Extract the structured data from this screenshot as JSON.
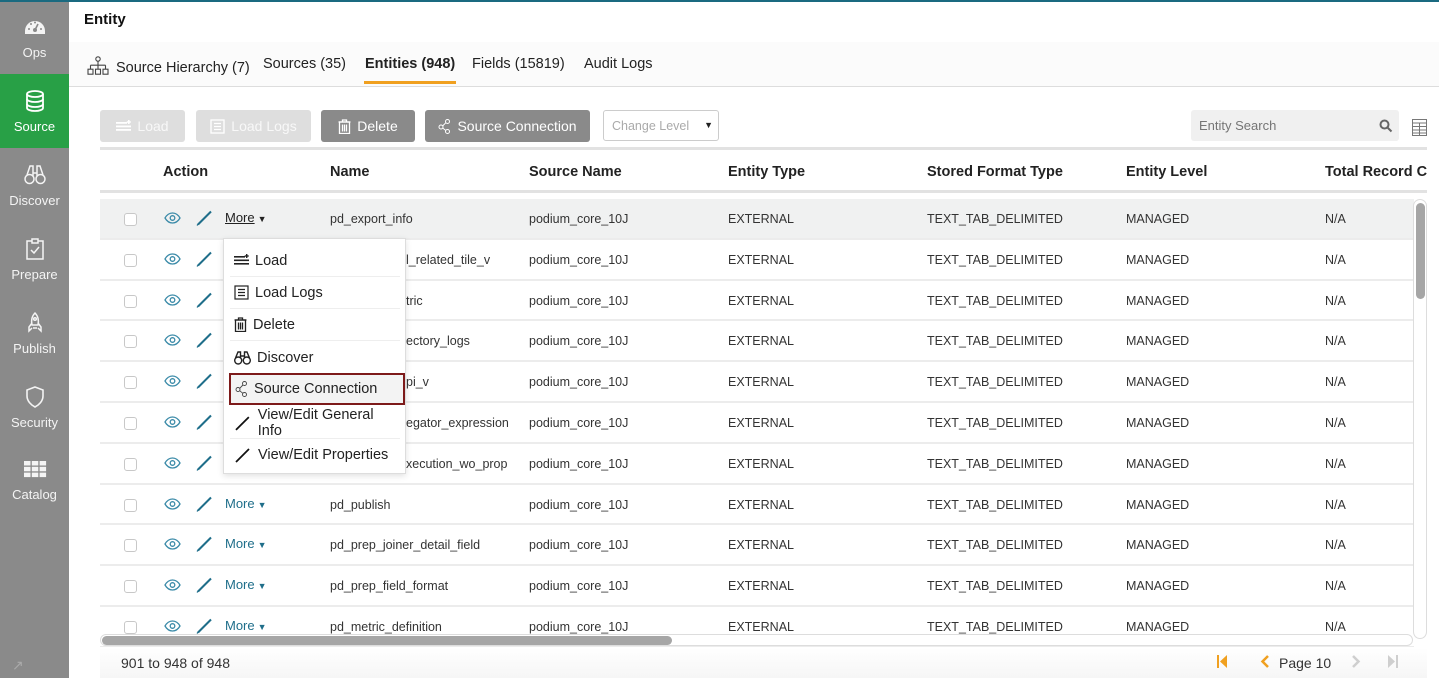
{
  "sidebar": {
    "items": [
      {
        "label": "Ops",
        "icon": "dashboard-gauge-icon",
        "active": false
      },
      {
        "label": "Source",
        "icon": "database-icon",
        "active": true
      },
      {
        "label": "Discover",
        "icon": "binoculars-icon",
        "active": false
      },
      {
        "label": "Prepare",
        "icon": "clipboard-check-icon",
        "active": false
      },
      {
        "label": "Publish",
        "icon": "rocket-icon",
        "active": false
      },
      {
        "label": "Security",
        "icon": "shield-icon",
        "active": false
      },
      {
        "label": "Catalog",
        "icon": "grid-icon",
        "active": false
      }
    ],
    "expand_icon": "↗"
  },
  "header": {
    "title": "Entity"
  },
  "tabs": [
    {
      "label": "Source Hierarchy (7)",
      "icon": "hierarchy-icon"
    },
    {
      "label": "Sources (35)"
    },
    {
      "label": "Entities (948)",
      "active": true
    },
    {
      "label": "Fields (15819)"
    },
    {
      "label": "Audit Logs"
    }
  ],
  "toolbar": {
    "load": "Load",
    "load_logs": "Load Logs",
    "delete": "Delete",
    "source_connection": "Source Connection",
    "change_level_placeholder": "Change Level",
    "search_placeholder": "Entity Search"
  },
  "table": {
    "columns": [
      "Action",
      "Name",
      "Source Name",
      "Entity Type",
      "Stored Format Type",
      "Entity Level",
      "Total Record Cou"
    ],
    "more_label": "More",
    "rows": [
      {
        "name": "pd_export_info",
        "source": "podium_core_10J",
        "type": "EXTERNAL",
        "format": "TEXT_TAB_DELIMITED",
        "level": "MANAGED",
        "records": "N/A"
      },
      {
        "name": "pd_related_tile_v",
        "visible_name": "l_related_tile_v",
        "source": "podium_core_10J",
        "type": "EXTERNAL",
        "format": "TEXT_TAB_DELIMITED",
        "level": "MANAGED",
        "records": "N/A"
      },
      {
        "name": "tric",
        "visible_name": "tric",
        "source": "podium_core_10J",
        "type": "EXTERNAL",
        "format": "TEXT_TAB_DELIMITED",
        "level": "MANAGED",
        "records": "N/A"
      },
      {
        "name": "ectory_logs",
        "visible_name": "ectory_logs",
        "source": "podium_core_10J",
        "type": "EXTERNAL",
        "format": "TEXT_TAB_DELIMITED",
        "level": "MANAGED",
        "records": "N/A"
      },
      {
        "name": "pi_v",
        "visible_name": "pi_v",
        "source": "podium_core_10J",
        "type": "EXTERNAL",
        "format": "TEXT_TAB_DELIMITED",
        "level": "MANAGED",
        "records": "N/A"
      },
      {
        "name": "egator_expression",
        "visible_name": "egator_expression",
        "source": "podium_core_10J",
        "type": "EXTERNAL",
        "format": "TEXT_TAB_DELIMITED",
        "level": "MANAGED",
        "records": "N/A"
      },
      {
        "name": "xecution_wo_prop",
        "visible_name": "xecution_wo_prop",
        "source": "podium_core_10J",
        "type": "EXTERNAL",
        "format": "TEXT_TAB_DELIMITED",
        "level": "MANAGED",
        "records": "N/A"
      },
      {
        "name": "pd_publish",
        "source": "podium_core_10J",
        "type": "EXTERNAL",
        "format": "TEXT_TAB_DELIMITED",
        "level": "MANAGED",
        "records": "N/A"
      },
      {
        "name": "pd_prep_joiner_detail_field",
        "source": "podium_core_10J",
        "type": "EXTERNAL",
        "format": "TEXT_TAB_DELIMITED",
        "level": "MANAGED",
        "records": "N/A"
      },
      {
        "name": "pd_prep_field_format",
        "source": "podium_core_10J",
        "type": "EXTERNAL",
        "format": "TEXT_TAB_DELIMITED",
        "level": "MANAGED",
        "records": "N/A"
      },
      {
        "name": "pd_metric_definition",
        "source": "podium_core_10J",
        "type": "EXTERNAL",
        "format": "TEXT_TAB_DELIMITED",
        "level": "MANAGED",
        "records": "N/A"
      }
    ]
  },
  "dropdown_menu": {
    "items": [
      {
        "label": "Load",
        "icon": "load-icon"
      },
      {
        "label": "Load Logs",
        "icon": "list-icon"
      },
      {
        "label": "Delete",
        "icon": "trash-icon"
      },
      {
        "label": "Discover",
        "icon": "binoculars-icon"
      },
      {
        "label": "Source Connection",
        "icon": "share-nodes-icon",
        "selected": true
      },
      {
        "label": "View/Edit General Info",
        "icon": "pencil-icon"
      },
      {
        "label": "View/Edit Properties",
        "icon": "pencil-icon"
      }
    ]
  },
  "footer": {
    "range": "901 to 948 of 948",
    "page_label": "Page 10"
  },
  "colors": {
    "active_nav": "#28a046",
    "accent_tab": "#f0a020",
    "link": "#1f6e8a",
    "selected_outline": "#7d1a1a",
    "top_line": "#1a6a80"
  }
}
